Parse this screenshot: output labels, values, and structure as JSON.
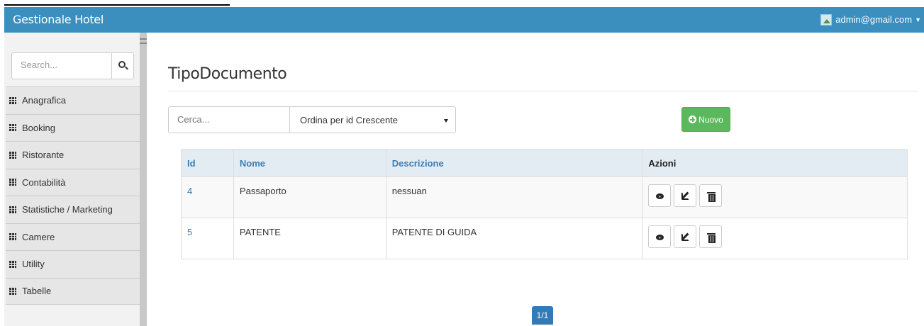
{
  "navbar": {
    "brand": "Gestionale Hotel",
    "user_email": "admin@gmail.com"
  },
  "sidebar": {
    "search_placeholder": "Search...",
    "items": [
      {
        "label": "Anagrafica"
      },
      {
        "label": "Booking"
      },
      {
        "label": "Ristorante"
      },
      {
        "label": "Contabilità"
      },
      {
        "label": "Statistiche / Marketing"
      },
      {
        "label": "Camere"
      },
      {
        "label": "Utility"
      },
      {
        "label": "Tabelle"
      }
    ]
  },
  "main": {
    "title": "TipoDocumento",
    "filter_placeholder": "Cerca...",
    "order_selected": "Ordina per id Crescente",
    "new_button": "Nuovo",
    "table": {
      "headers": [
        "Id",
        "Nome",
        "Descrizione",
        "Azioni"
      ],
      "rows": [
        {
          "id": "4",
          "nome": "Passaporto",
          "descrizione": "nessuan"
        },
        {
          "id": "5",
          "nome": "PATENTE",
          "descrizione": "PATENTE DI GUIDA"
        }
      ]
    },
    "pagination": "1/1"
  },
  "colors": {
    "navbar": "#3a8fbf",
    "success": "#5cb85c",
    "link": "#3a7eb5",
    "pager": "#337ab7"
  }
}
